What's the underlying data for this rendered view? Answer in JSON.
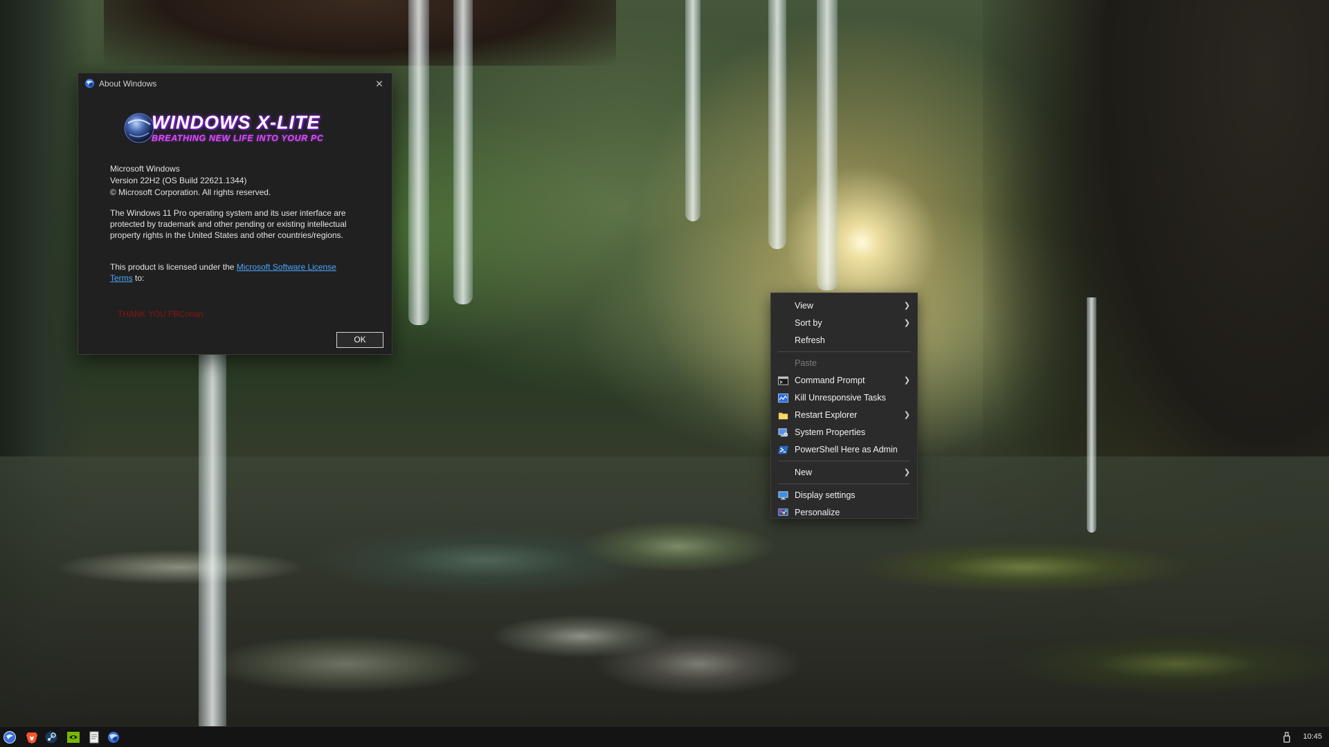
{
  "about_dialog": {
    "title": "About Windows",
    "logo_text": "WINDOWS X-LITE",
    "logo_tagline": "BREATHING NEW LIFE INTO YOUR PC",
    "product_name": "Microsoft Windows",
    "version": "Version 22H2 (OS Build 22621.1344)",
    "copyright": "© Microsoft Corporation. All rights reserved.",
    "description": "The Windows 11 Pro operating system and its user interface are protected by trademark and other pending or existing intellectual property rights in the United States and other countries/regions.",
    "license_prefix": "This product is licensed under the ",
    "license_link": "Microsoft Software License Terms",
    "license_suffix": " to:",
    "licensee": "THANK YOU FBConan",
    "ok_label": "OK"
  },
  "context_menu": {
    "items": [
      {
        "label": "View",
        "submenu": true
      },
      {
        "label": "Sort by",
        "submenu": true
      },
      {
        "label": "Refresh",
        "submenu": false
      },
      {
        "label": "Paste",
        "submenu": false,
        "disabled": true
      },
      {
        "label": "Command Prompt",
        "submenu": true,
        "icon": "command-prompt-icon"
      },
      {
        "label": "Kill Unresponsive Tasks",
        "submenu": false,
        "icon": "task-manager-icon"
      },
      {
        "label": "Restart Explorer",
        "submenu": true,
        "icon": "folder-icon"
      },
      {
        "label": "System Properties",
        "submenu": false,
        "icon": "system-properties-icon"
      },
      {
        "label": "PowerShell Here as Admin",
        "submenu": false,
        "icon": "powershell-icon"
      },
      {
        "label": "New",
        "submenu": true
      },
      {
        "label": "Display settings",
        "submenu": false,
        "icon": "display-icon"
      },
      {
        "label": "Personalize",
        "submenu": false,
        "icon": "personalize-icon"
      }
    ]
  },
  "taskbar": {
    "apps": [
      "start-icon",
      "brave-browser-icon",
      "steam-icon",
      "nvidia-icon",
      "notepad-icon",
      "windows-x-lite-icon"
    ],
    "clock": "10:45"
  },
  "colors": {
    "dialog_bg": "#202020",
    "menu_bg": "#2b2b2b",
    "link": "#4ca6ff",
    "licensee_text": "#8b1414",
    "taskbar_bg": "#141414"
  }
}
